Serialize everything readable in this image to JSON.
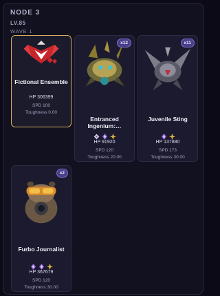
{
  "header": {
    "node": "NODE 3",
    "level": "LV.85",
    "wave": "WAVE 1"
  },
  "enemies": [
    {
      "name": "Fictional Ensemble",
      "hp": "HP 306399",
      "spd": "SPD 100",
      "toughness": "Toughness 0.00",
      "count": "",
      "weaknesses": [],
      "selected": true
    },
    {
      "name": "Entranced Ingenium:…",
      "hp": "HP 91920",
      "spd": "SPD 120",
      "toughness": "Toughness 20.00",
      "count": "x12",
      "weaknesses": [
        "quantum-icon",
        "imaginary-icon",
        "physical-icon"
      ],
      "selected": false
    },
    {
      "name": "Juvenile Sting",
      "hp": "HP 137880",
      "spd": "SPD 173",
      "toughness": "Toughness 30.00",
      "count": "x11",
      "weaknesses": [
        "imaginary-icon",
        "physical-icon"
      ],
      "selected": false
    },
    {
      "name": "Furbo Journalist",
      "hp": "HP 367679",
      "spd": "SPD 120",
      "toughness": "Toughness 30.00",
      "count": "x2",
      "weaknesses": [
        "imaginary-icon",
        "imaginary-icon",
        "physical-icon"
      ],
      "selected": false
    }
  ],
  "colors": {
    "accent_selected": "#d7b05a",
    "badge": "#4a3f8a",
    "imaginary": "#8a5fd0",
    "physical": "#d9b342"
  }
}
